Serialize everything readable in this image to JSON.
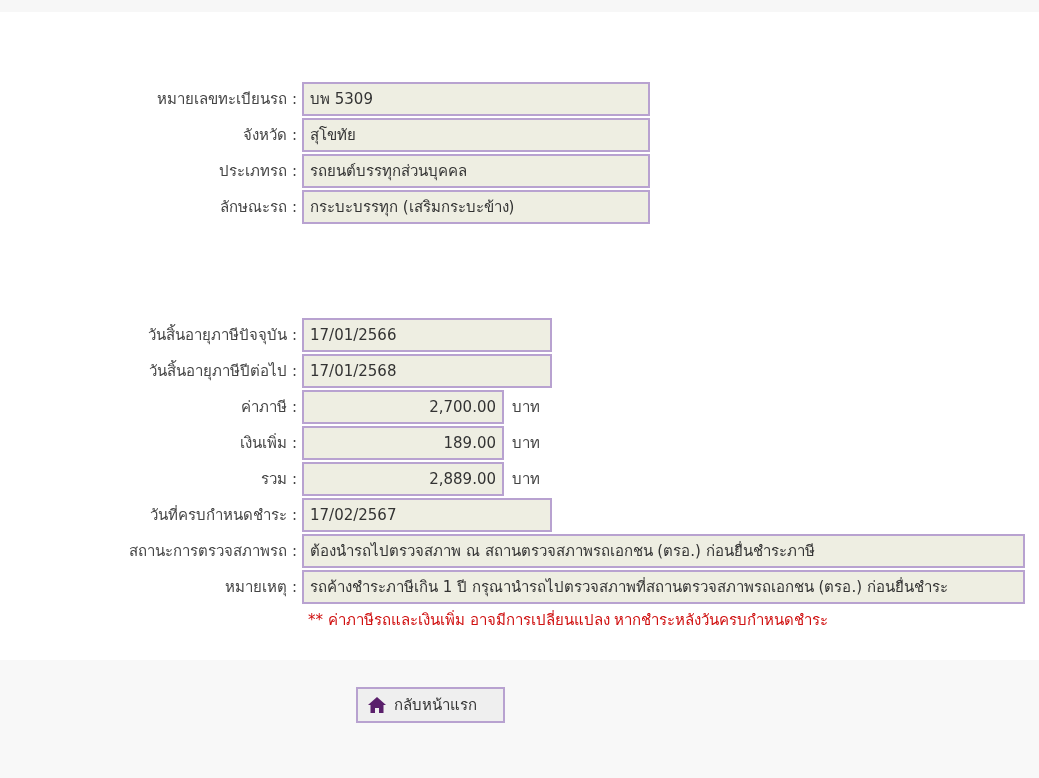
{
  "vehicle": [
    {
      "label": "หมายเลขทะเบียนรถ :",
      "value": "บพ 5309",
      "kind": "text"
    },
    {
      "label": "จังหวัด :",
      "value": "สุโขทัย",
      "kind": "text"
    },
    {
      "label": "ประเภทรถ :",
      "value": "รถยนต์บรรทุกส่วนบุคคล",
      "kind": "text"
    },
    {
      "label": "ลักษณะรถ :",
      "value": "กระบะบรรทุก (เสริมกระบะข้าง)",
      "kind": "text"
    }
  ],
  "tax": [
    {
      "label": "วันสิ้นอายุภาษีปัจจุบัน :",
      "value": "17/01/2566",
      "kind": "date"
    },
    {
      "label": "วันสิ้นอายุภาษีปีต่อไป :",
      "value": "17/01/2568",
      "kind": "date"
    },
    {
      "label": "ค่าภาษี :",
      "value": "2,700.00",
      "kind": "amount",
      "unit": "บาท"
    },
    {
      "label": "เงินเพิ่ม :",
      "value": "189.00",
      "kind": "amount",
      "unit": "บาท"
    },
    {
      "label": "รวม :",
      "value": "2,889.00",
      "kind": "amount",
      "unit": "บาท"
    },
    {
      "label": "วันที่ครบกำหนดชำระ :",
      "value": "17/02/2567",
      "kind": "date"
    },
    {
      "label": "สถานะการตรวจสภาพรถ :",
      "value": "ต้องนำรถไปตรวจสภาพ ณ สถานตรวจสภาพรถเอกชน (ตรอ.) ก่อนยื่นชำระภาษี",
      "kind": "long"
    },
    {
      "label": "หมายเหตุ :",
      "value": "รถค้างชำระภาษีเกิน 1 ปี กรุณานำรถไปตรวจสภาพที่สถานตรวจสภาพรถเอกชน (ตรอ.) ก่อนยื่นชำระ",
      "kind": "long"
    }
  ],
  "warning": "** ค่าภาษีรถและเงินเพิ่ม อาจมีการเปลี่ยนแปลง หากชำระหลังวันครบกำหนดชำระ",
  "home_button": "กลับหน้าแรก"
}
